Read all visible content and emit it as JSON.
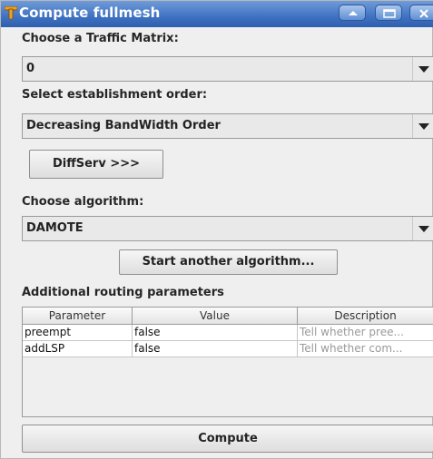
{
  "window": {
    "title": "Compute fullmesh",
    "icons": {
      "app": "app-logo-icon",
      "minimize": "minimize-icon",
      "maximize": "maximize-icon",
      "close": "close-icon"
    },
    "colors": {
      "titlebar": "#3f72c2",
      "background": "#efefef"
    }
  },
  "traffic_matrix": {
    "label": "Choose a Traffic Matrix:",
    "selected": "0"
  },
  "establishment_order": {
    "label": "Select establishment order:",
    "selected": "Decreasing BandWidth Order"
  },
  "diffserv_button": {
    "label": "DiffServ >>>"
  },
  "algorithm": {
    "label": "Choose algorithm:",
    "selected": "DAMOTE"
  },
  "start_another_button": {
    "label": "Start another algorithm..."
  },
  "routing_parameters": {
    "label": "Additional routing parameters",
    "columns": [
      "Parameter",
      "Value",
      "Description"
    ],
    "rows": [
      {
        "parameter": "preempt",
        "value": "false",
        "description": "Tell whether pree..."
      },
      {
        "parameter": "addLSP",
        "value": "false",
        "description": "Tell whether com..."
      }
    ]
  },
  "compute_button": {
    "label": "Compute"
  }
}
